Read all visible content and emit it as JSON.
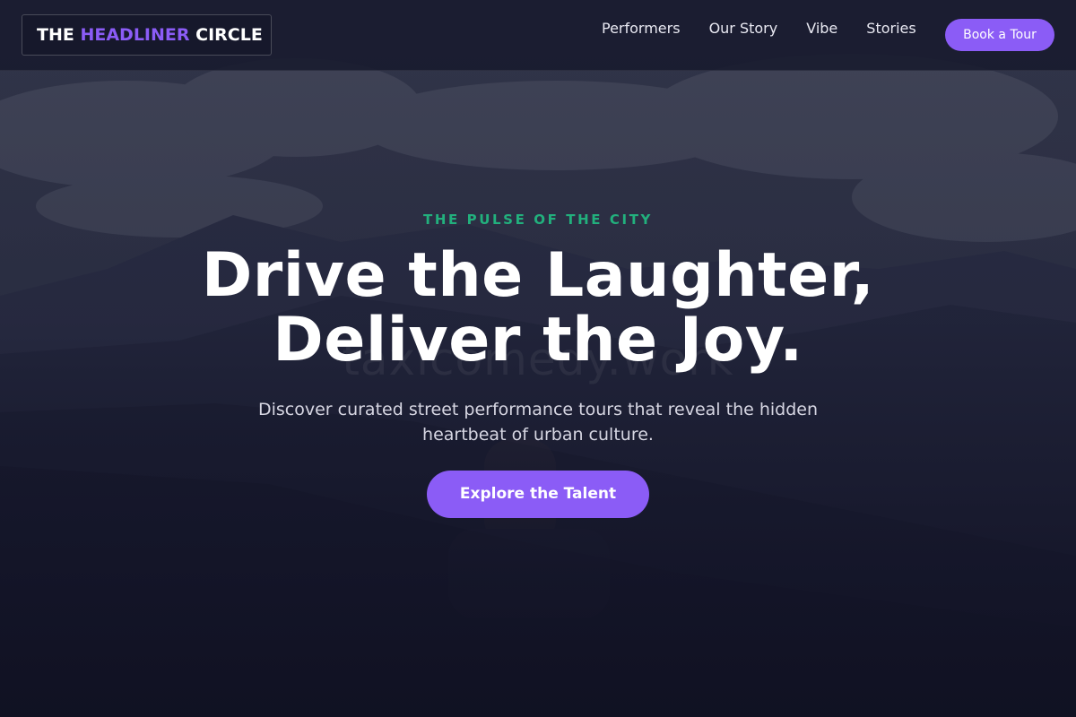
{
  "header": {
    "logo": {
      "part1": "THE",
      "part2": "HEADLINER",
      "part3": "CIRCLE"
    },
    "nav": [
      {
        "label": "Performers"
      },
      {
        "label": "Our Story"
      },
      {
        "label": "Vibe"
      },
      {
        "label": "Stories"
      }
    ],
    "cta_label": "Book a Tour"
  },
  "hero": {
    "eyebrow": "THE PULSE OF THE CITY",
    "headline_line1": "Drive the Laughter,",
    "headline_line2": "Deliver the Joy.",
    "subtext": "Discover curated street performance tours that reveal the hidden heartbeat of urban culture.",
    "cta_label": "Explore the Talent",
    "watermark": "taxicomedy.work"
  },
  "colors": {
    "accent": "#8b5cf6",
    "eyebrow": "#22b07d",
    "background": "#14162a"
  }
}
